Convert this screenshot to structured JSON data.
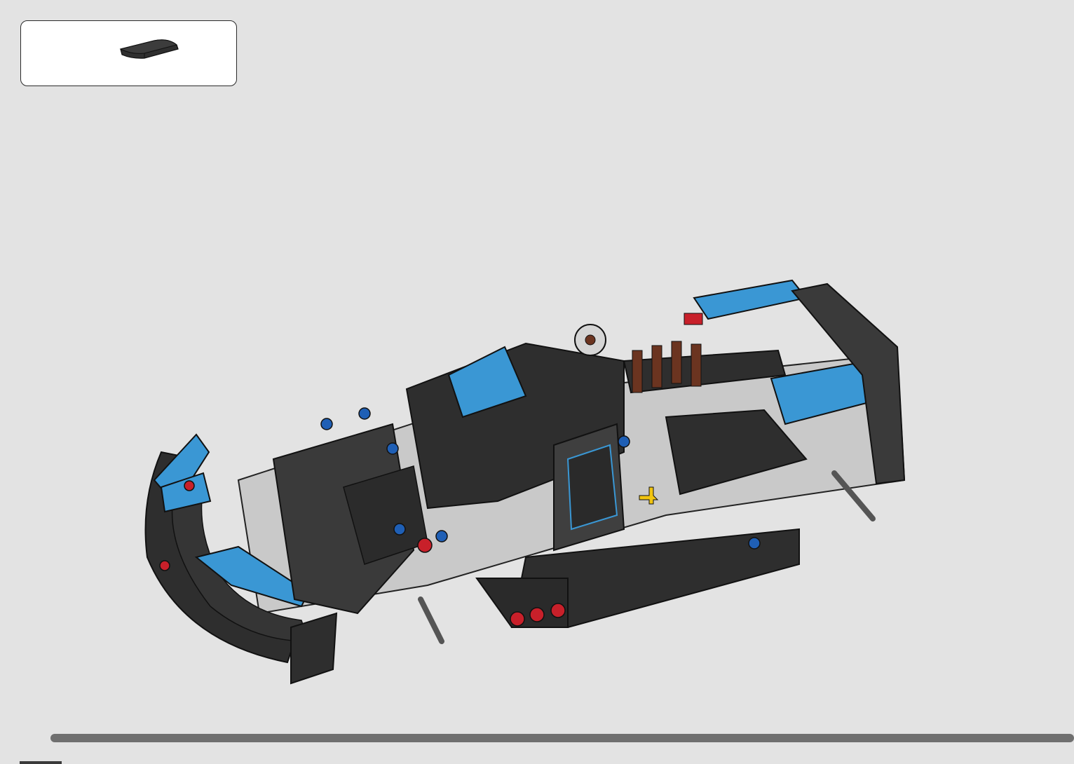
{
  "instruction_page": {
    "parts_callout": {
      "part_icon": "curved-slope-brick-icon",
      "part_color": "#2f2f2f"
    },
    "assembly_model": {
      "icon": "vehicle-chassis-assembly-icon",
      "colors": {
        "body": "#2e2e2e",
        "accent_blue": "#3a97d4",
        "frame_gray": "#c9c9c9",
        "pin_red": "#c8202a",
        "pin_blue": "#1f5fb5",
        "axle_brown": "#6b3420",
        "axle_yellow": "#f1c40f"
      }
    },
    "progress": {
      "fraction": 1.0,
      "color": "#6f6f6f"
    },
    "page_number": ""
  }
}
